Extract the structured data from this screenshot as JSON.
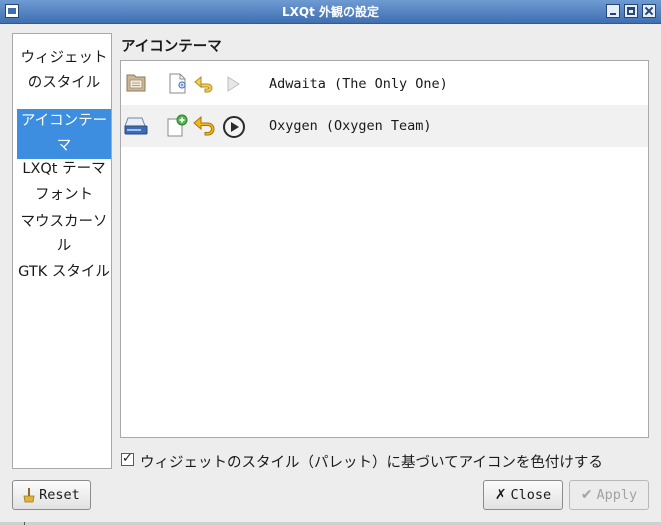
{
  "window": {
    "title": "LXQt 外観の設定"
  },
  "sidebar": {
    "items": [
      {
        "label": "ウィジェットのスタイル",
        "selected": false
      },
      {
        "label": "アイコンテーマ",
        "selected": true
      },
      {
        "label": "LXQt テーマ",
        "selected": false
      },
      {
        "label": "フォント",
        "selected": false
      },
      {
        "label": "マウスカーソル",
        "selected": false
      },
      {
        "label": "GTK スタイル",
        "selected": false
      }
    ]
  },
  "main": {
    "section_title": "アイコンテーマ",
    "themes": [
      {
        "name": "Adwaita (The Only One)",
        "icons": [
          "folder-icon",
          "new-document-icon",
          "undo-icon",
          "play-icon"
        ]
      },
      {
        "name": "Oxygen (Oxygen Team)",
        "icons": [
          "drive-icon",
          "new-document-icon",
          "undo-icon",
          "play-icon"
        ]
      }
    ],
    "colorize_checkbox": {
      "label": "ウィジェットのスタイル（パレット）に基づいてアイコンを色付けする",
      "checked": true
    }
  },
  "buttons": {
    "reset": "Reset",
    "close": "Close",
    "apply": "Apply"
  }
}
